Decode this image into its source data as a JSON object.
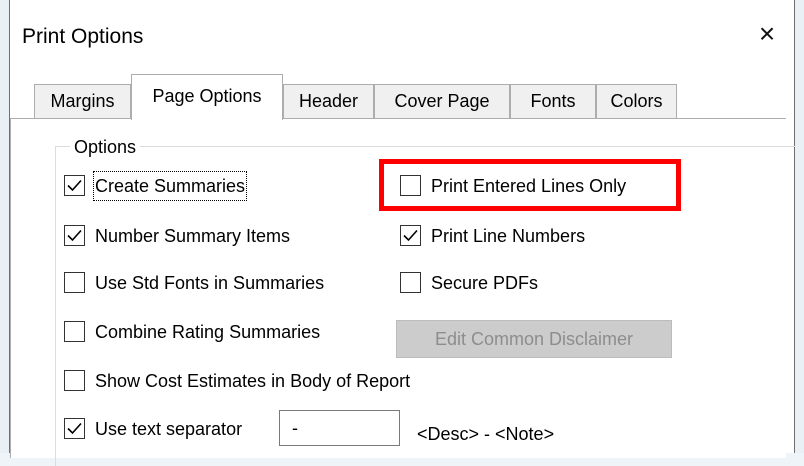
{
  "dialog": {
    "title": "Print Options",
    "close_icon": "close-icon ×"
  },
  "tabs": [
    {
      "label": "Margins",
      "active": false
    },
    {
      "label": "Page Options",
      "active": true
    },
    {
      "label": "Header",
      "active": false
    },
    {
      "label": "Cover Page",
      "active": false
    },
    {
      "label": "Fonts",
      "active": false
    },
    {
      "label": "Colors",
      "active": false
    }
  ],
  "options": {
    "group_label": "Options",
    "create_summaries": {
      "label": "Create Summaries",
      "checked": true
    },
    "print_entered_lines_only": {
      "label": "Print Entered Lines Only",
      "checked": false
    },
    "number_summary_items": {
      "label": "Number Summary Items",
      "checked": true
    },
    "print_line_numbers": {
      "label": "Print Line Numbers",
      "checked": true
    },
    "use_std_fonts": {
      "label": "Use Std Fonts in Summaries",
      "checked": false
    },
    "secure_pdfs": {
      "label": "Secure PDFs",
      "checked": false
    },
    "combine_rating": {
      "label": "Combine Rating Summaries",
      "checked": false
    },
    "edit_disclaimer_button": "Edit Common Disclaimer",
    "show_cost_estimates": {
      "label": "Show Cost Estimates in Body of Report",
      "checked": false
    },
    "use_text_separator": {
      "label": "Use text separator",
      "checked": true
    },
    "separator_value": "-",
    "separator_preview": "<Desc> - <Note>"
  },
  "colors": {
    "highlight": "#ff0000",
    "disabled_button_bg": "#cccccc",
    "disabled_button_text": "#8d8d8d"
  }
}
